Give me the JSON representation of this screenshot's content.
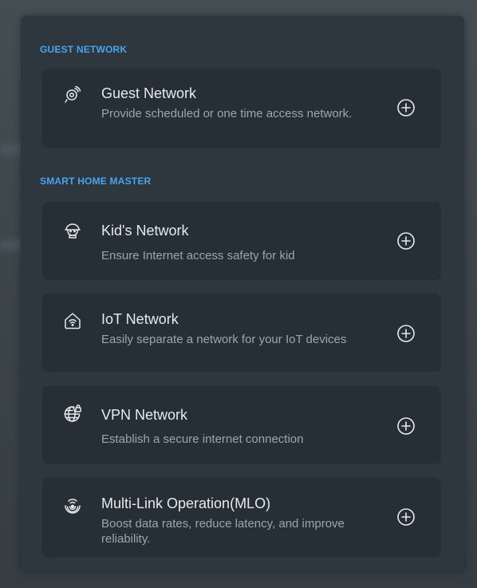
{
  "sections": {
    "guest": {
      "title": "GUEST NETWORK",
      "items": [
        {
          "icon": "guest-network-icon",
          "title": "Guest Network",
          "description": "Provide scheduled or one time access network."
        }
      ]
    },
    "smart_home": {
      "title": "SMART HOME MASTER",
      "items": [
        {
          "icon": "kid-icon",
          "title": "Kid's Network",
          "description": "Ensure Internet access safety for kid"
        },
        {
          "icon": "iot-home-wifi-icon",
          "title": "IoT Network",
          "description": "Easily separate a network for your IoT devices"
        },
        {
          "icon": "vpn-globe-lock-icon",
          "title": "VPN Network",
          "description": "Establish a secure internet connection"
        },
        {
          "icon": "mlo-signal-icon",
          "title": "Multi-Link Operation(MLO)",
          "description": "Boost data rates, reduce latency, and improve reliability."
        }
      ]
    }
  },
  "colors": {
    "accent": "#4aa3ef",
    "panel": "#2e373d",
    "card": "#262f35",
    "title_text": "#e6eaed",
    "desc_text": "#9aa6ae"
  },
  "add_icon": "plus-circle-icon"
}
